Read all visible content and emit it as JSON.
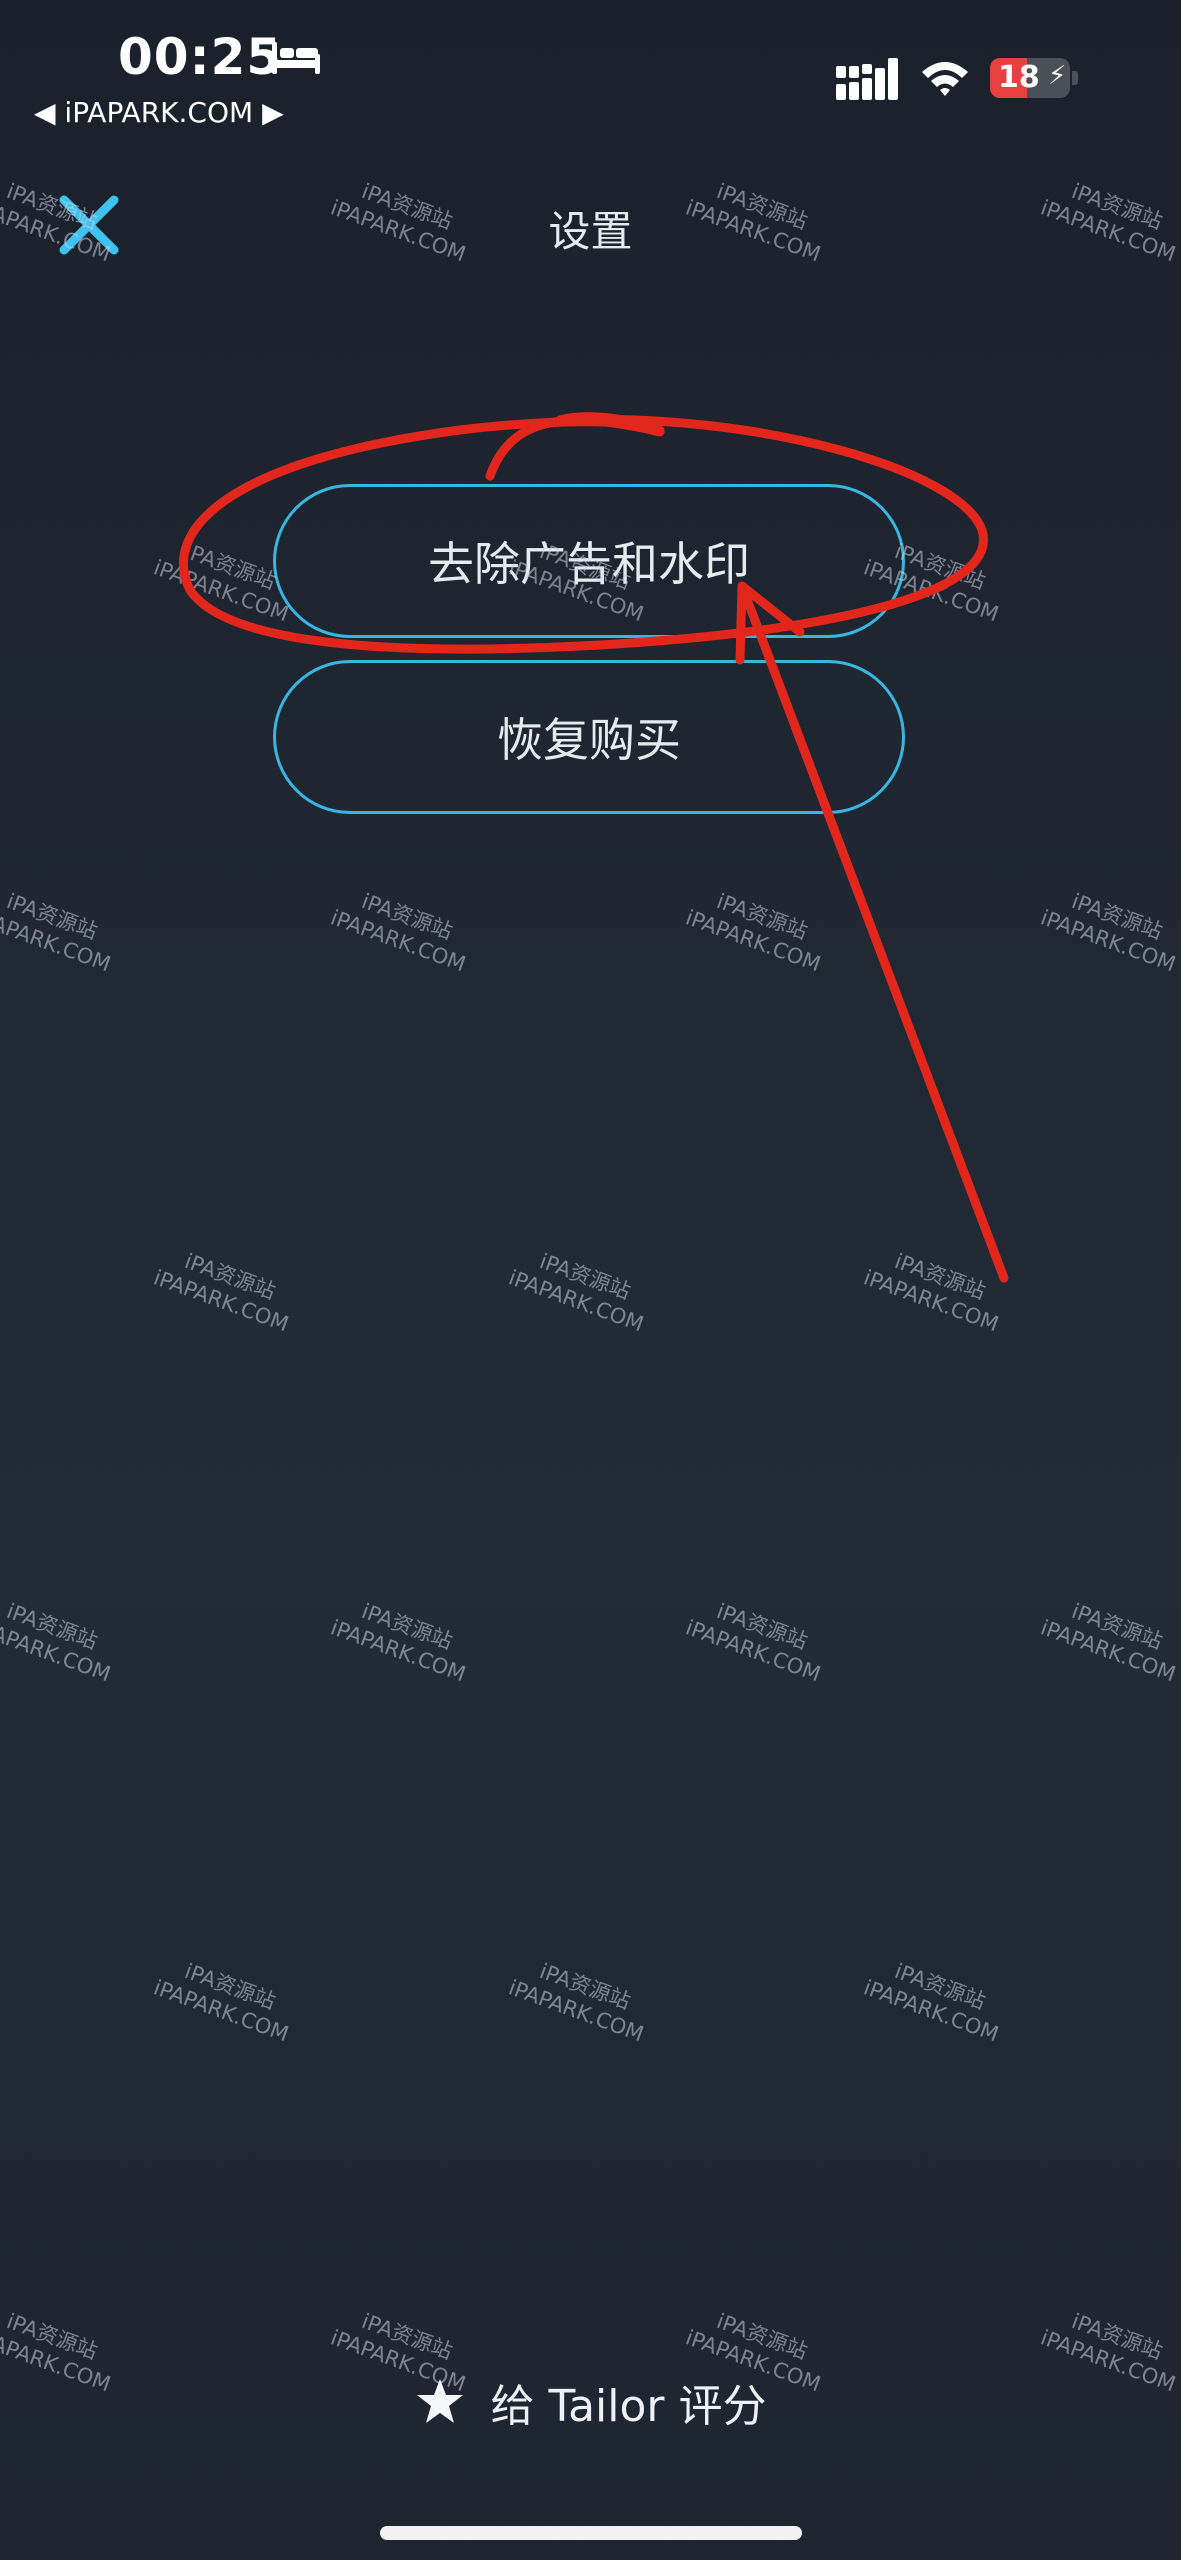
{
  "status_bar": {
    "time": "00:25",
    "back_app": "◀ iPAPARK.COM ▶",
    "battery_level": "18",
    "battery_fraction": 0.18
  },
  "nav": {
    "title": "设置",
    "close_icon": "close-x-icon"
  },
  "buttons": {
    "remove_ads": "去除广告和水印",
    "restore": "恢复购买"
  },
  "rate": {
    "icon": "star-icon",
    "label": "给 Tailor 评分"
  },
  "watermark": {
    "line1": "iPA资源站",
    "line2": "iPAPARK.COM"
  },
  "colors": {
    "accent": "#38b6e0",
    "annotation": "#e2261b",
    "battery_low": "#e84040"
  }
}
